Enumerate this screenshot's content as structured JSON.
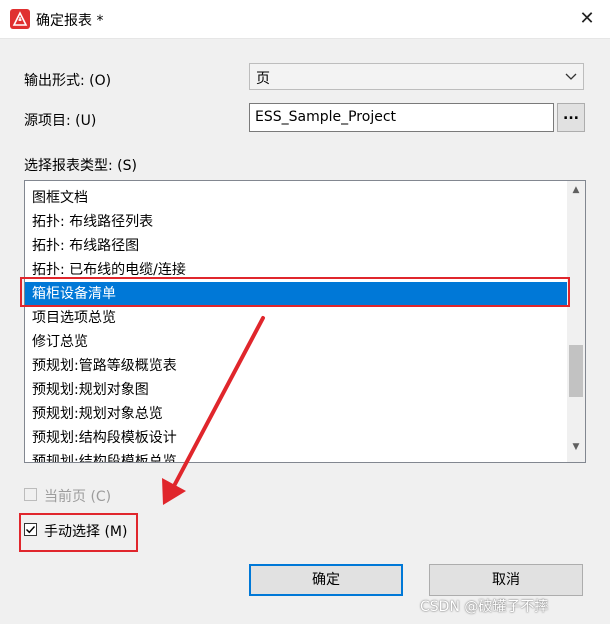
{
  "window": {
    "title": "确定报表 *",
    "close_symbol": "✕"
  },
  "output_form": {
    "label": "输出形式: (O)",
    "value": "页"
  },
  "source_project": {
    "label": "源项目: (U)",
    "value": "ESS_Sample_Project",
    "browse_label": "..."
  },
  "report_type": {
    "label": "选择报表类型: (S)",
    "items": [
      "图框文档",
      "拓扑: 布线路径列表",
      "拓扑: 布线路径图",
      "拓扑: 已布线的电缆/连接",
      "箱柜设备清单",
      "项目选项总览",
      "修订总览",
      "预规划:管路等级概览表",
      "预规划:规划对象图",
      "预规划:规划对象总览",
      "预规划:结构段模板设计",
      "预规划:结构段模板总览"
    ],
    "selected_index": 4
  },
  "current_page": {
    "label": "当前页 (C)",
    "checked": false,
    "enabled": false
  },
  "manual_select": {
    "label": "手动选择 (M)",
    "checked": true
  },
  "buttons": {
    "ok": "确定",
    "cancel": "取消"
  },
  "watermark": "CSDN @破罐子不摔",
  "colors": {
    "selection": "#0078d7",
    "annotation": "#e0262c"
  }
}
